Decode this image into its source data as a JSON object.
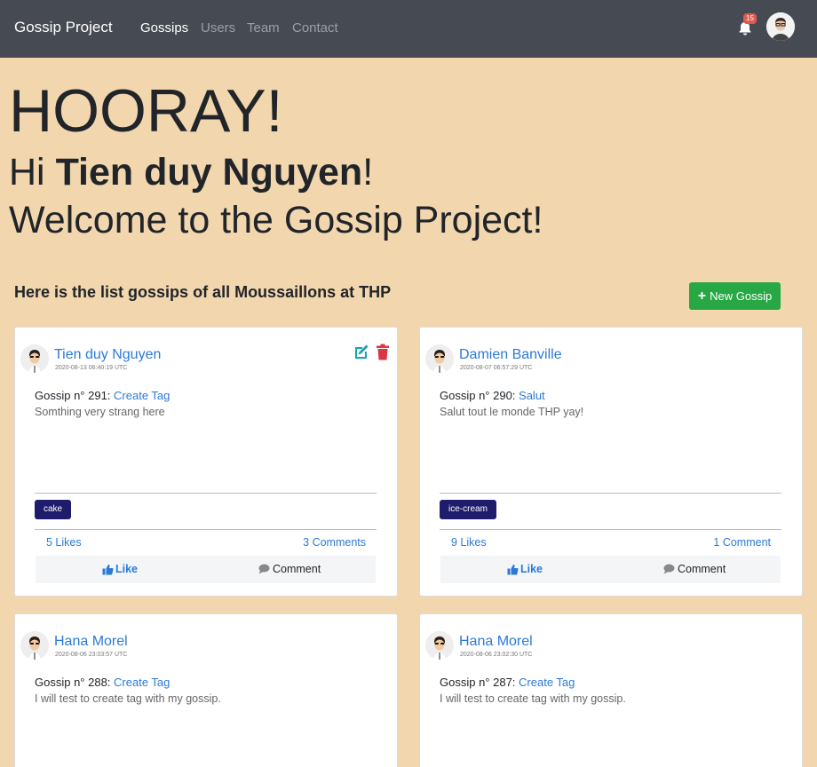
{
  "navbar": {
    "brand": "Gossip Project",
    "links": [
      "Gossips",
      "Users",
      "Team",
      "Contact"
    ],
    "notification_count": "15"
  },
  "hero": {
    "line1": "HOORAY!",
    "greeting_prefix": "Hi ",
    "user_name": "Tien duy Nguyen",
    "greeting_suffix": "!",
    "line3": "Welcome to the Gossip Project!"
  },
  "list": {
    "title": "Here is the list gossips of all Moussaillons at THP",
    "new_button": "New Gossip"
  },
  "gossips": [
    {
      "author": "Tien duy Nguyen",
      "date": "2020-08-13 06:40:19 UTC",
      "number_label": "Gossip n° 291: ",
      "title": "Create Tag",
      "content": "Somthing very strang here",
      "tag": "cake",
      "likes": "5 Likes",
      "comments": "3 Comments",
      "like_label": "Like",
      "comment_label": "Comment"
    },
    {
      "author": "Damien Banville",
      "date": "2020-08-07 06:57:29 UTC",
      "number_label": "Gossip n° 290: ",
      "title": "Salut",
      "content": "Salut tout le monde THP yay!",
      "tag": "ice-cream",
      "likes": "9 Likes",
      "comments": "1 Comment",
      "like_label": "Like",
      "comment_label": "Comment"
    },
    {
      "author": "Hana Morel",
      "date": "2020-08-06 23:03:57 UTC",
      "number_label": "Gossip n° 288: ",
      "title": "Create Tag",
      "content": "I will test to create tag with my gossip."
    },
    {
      "author": "Hana Morel",
      "date": "2020-08-06 23:02:30 UTC",
      "number_label": "Gossip n° 287: ",
      "title": "Create Tag",
      "content": "I will test to create tag with my gossip."
    }
  ],
  "colors": {
    "background": "#f2d6ae",
    "navbar": "#454a53",
    "link": "#2a7ad9",
    "new_button": "#28a745",
    "tag": "#1f1c6b",
    "edit": "#17a2b8",
    "delete": "#dc3545"
  },
  "icons": [
    "bell-icon",
    "user-avatar",
    "plus-icon",
    "edit-icon",
    "trash-icon",
    "thumbs-up-icon",
    "comment-icon"
  ]
}
